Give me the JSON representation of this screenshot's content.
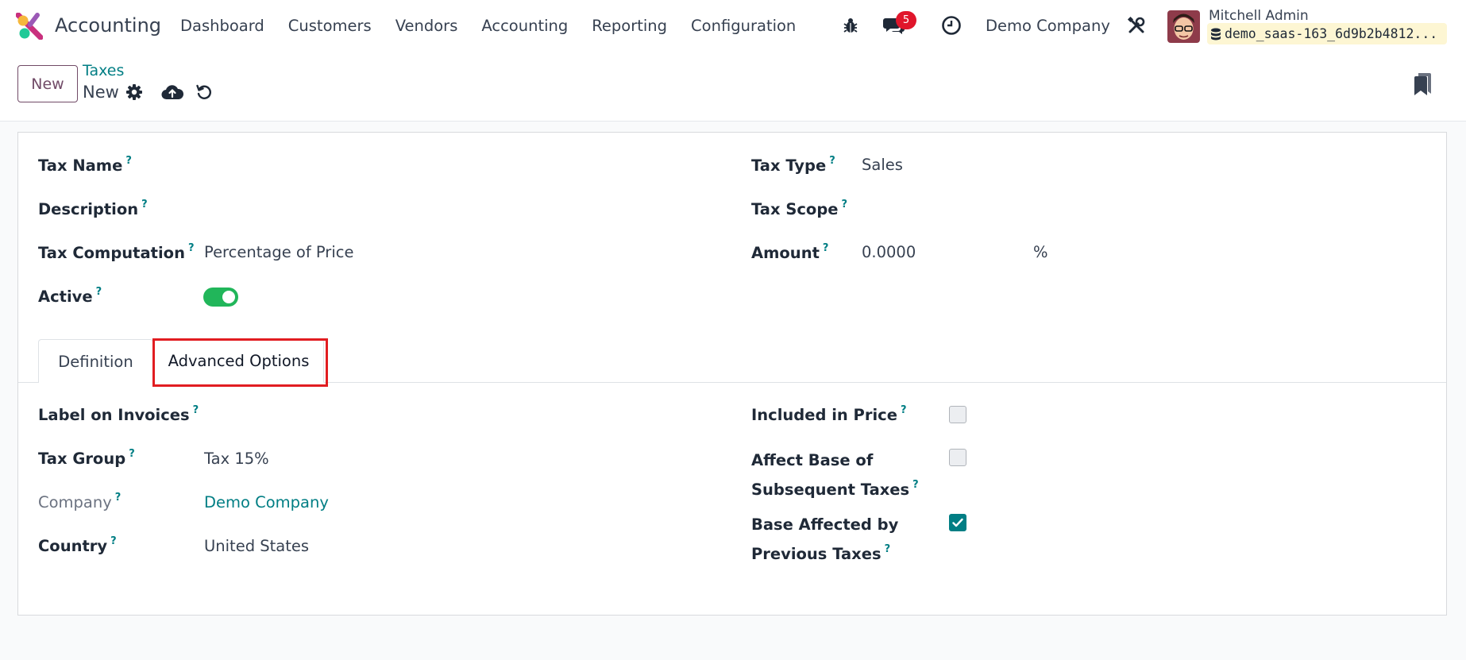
{
  "navbar": {
    "app_name": "Accounting",
    "menu": [
      "Dashboard",
      "Customers",
      "Vendors",
      "Accounting",
      "Reporting",
      "Configuration"
    ],
    "message_count": "5",
    "company": "Demo Company",
    "user_name": "Mitchell Admin",
    "database": "demo_saas-163_6d9b2b4812..."
  },
  "control_panel": {
    "new_label": "New",
    "breadcrumb_parent": "Taxes",
    "breadcrumb_current": "New"
  },
  "form": {
    "tax_name_label": "Tax Name",
    "description_label": "Description",
    "tax_computation_label": "Tax Computation",
    "tax_computation_value": "Percentage of Price",
    "active_label": "Active",
    "active": true,
    "tax_type_label": "Tax Type",
    "tax_type_value": "Sales",
    "tax_scope_label": "Tax Scope",
    "amount_label": "Amount",
    "amount_value": "0.0000",
    "amount_unit": "%",
    "help_mark": "?"
  },
  "tabs": {
    "definition": "Definition",
    "advanced": "Advanced Options",
    "active_tab": "Advanced Options"
  },
  "advanced": {
    "label_on_invoices_label": "Label on Invoices",
    "tax_group_label": "Tax Group",
    "tax_group_value": "Tax 15%",
    "company_label": "Company",
    "company_value": "Demo Company",
    "country_label": "Country",
    "country_value": "United States",
    "included_in_price_label": "Included in Price",
    "included_in_price": false,
    "affect_base_label_1": "Affect Base of",
    "affect_base_label_2": "Subsequent Taxes",
    "affect_base": false,
    "base_affected_label_1": "Base Affected by",
    "base_affected_label_2": "Previous Taxes",
    "base_affected": true
  },
  "colors": {
    "brand": "#714b67",
    "link": "#017e84",
    "toggle_on": "#21b65a",
    "badge": "#e0162b",
    "highlight": "#e11d21"
  }
}
